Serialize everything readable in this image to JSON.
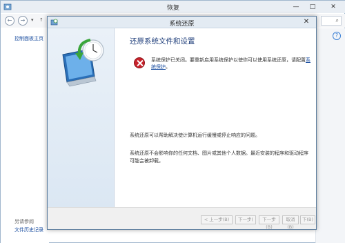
{
  "background_window": {
    "title": "恢复",
    "controls": {
      "minimize": "—",
      "maximize": "□",
      "close": "✕"
    },
    "nav": {
      "back": "←",
      "forward": "→",
      "dropdown": "▾",
      "up": "↑"
    },
    "search_icon_text": "⌕",
    "left_panel": {
      "link": "控制面板主页",
      "see_also_label": "另请参阅",
      "history_link": "文件历史记录"
    },
    "help_icon": "?"
  },
  "dialog": {
    "title": "系统还原",
    "close": "✕",
    "heading": "还原系统文件和设置",
    "error_text": "系统保护已关闭。要重新启用系统保护以使你可以使用系统还原，请配置",
    "error_link": "系统保护",
    "error_text_end": "。",
    "para1": "系统还原可以帮助解决使计算机运行缓慢或停止响应的问题。",
    "para2": "系统还原不会影响你的任何文档、图片或其他个人数据。最近安装的程序和驱动程序可能会被卸载。",
    "buttons": {
      "back": "< 上一步(B)",
      "next": "下一步(",
      "next2": "下一步(B)",
      "b4": "取消(B)",
      "b5": "下(B)"
    }
  },
  "colors": {
    "accent": "#1c4fa0",
    "heading": "#1e3d7a",
    "error": "#c8232c",
    "sidebar": "#dbe7f3"
  }
}
